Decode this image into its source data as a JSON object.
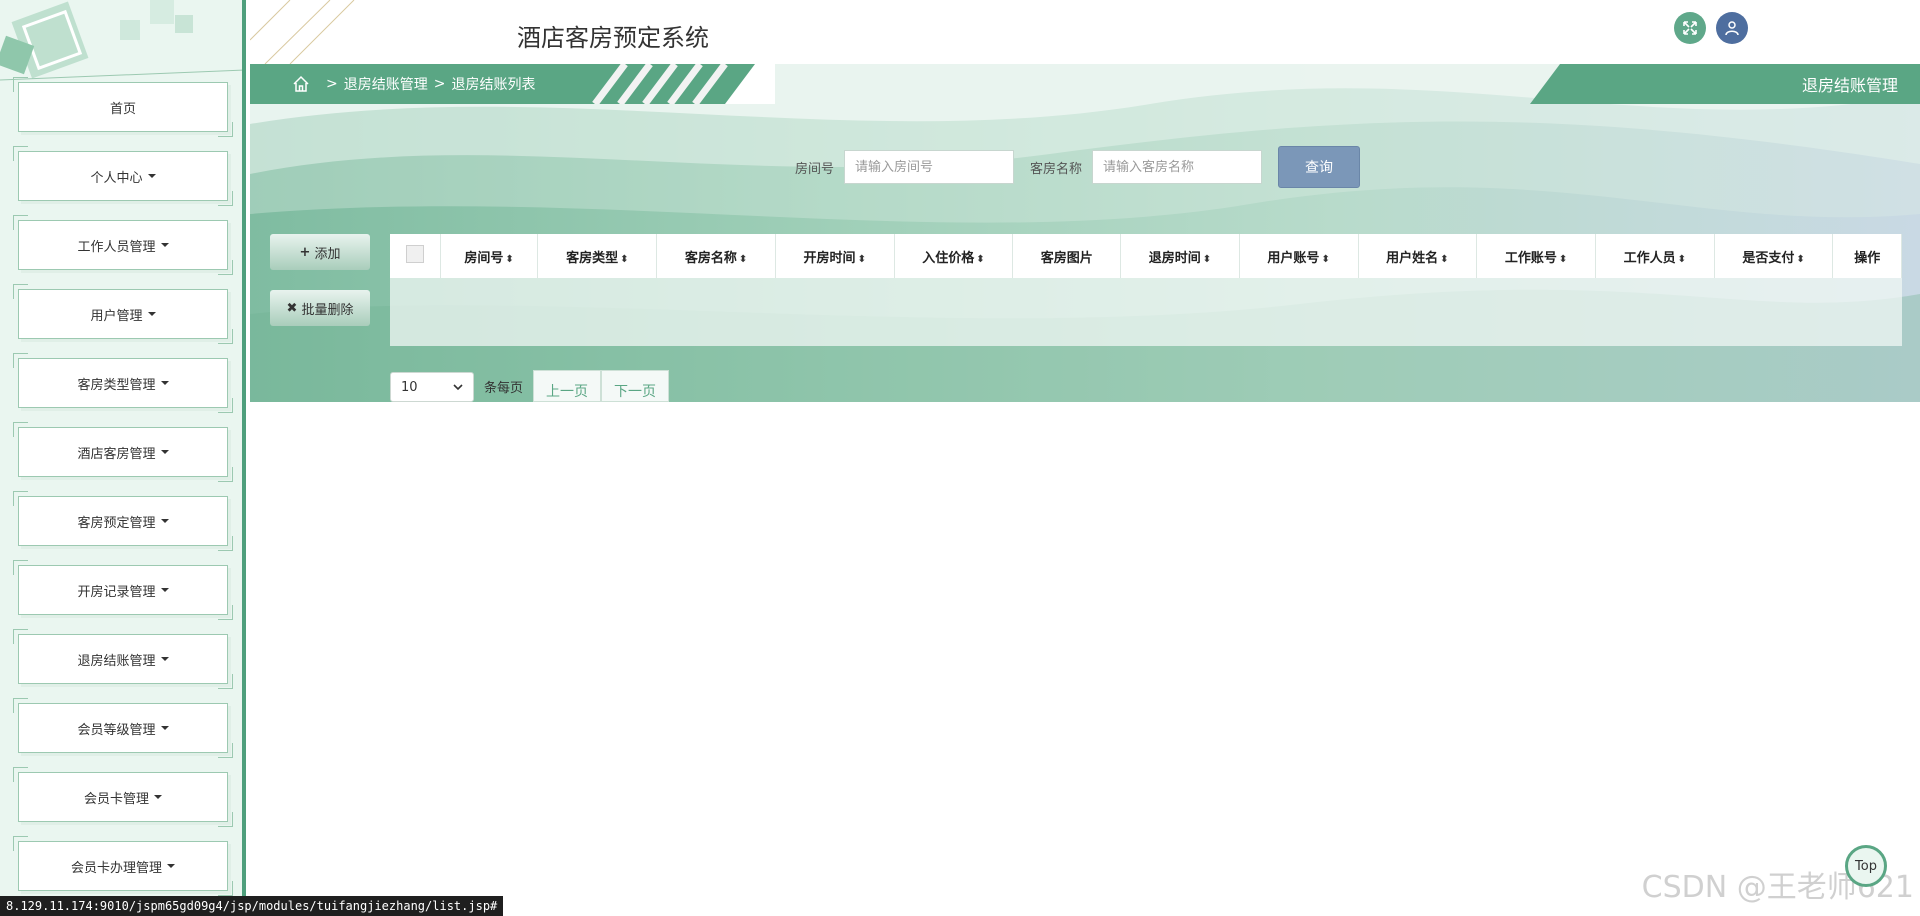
{
  "app": {
    "title": "酒店客房预定系统"
  },
  "sidebar": {
    "items": [
      {
        "label": "首页",
        "has_caret": false
      },
      {
        "label": "个人中心",
        "has_caret": true
      },
      {
        "label": "工作人员管理",
        "has_caret": true
      },
      {
        "label": "用户管理",
        "has_caret": true
      },
      {
        "label": "客房类型管理",
        "has_caret": true
      },
      {
        "label": "酒店客房管理",
        "has_caret": true
      },
      {
        "label": "客房预定管理",
        "has_caret": true
      },
      {
        "label": "开房记录管理",
        "has_caret": true
      },
      {
        "label": "退房结账管理",
        "has_caret": true
      },
      {
        "label": "会员等级管理",
        "has_caret": true
      },
      {
        "label": "会员卡管理",
        "has_caret": true
      },
      {
        "label": "会员卡办理管理",
        "has_caret": true
      }
    ]
  },
  "header": {
    "expand_icon": "expand-icon",
    "user_icon": "user-icon"
  },
  "breadcrumb": {
    "sep": ">",
    "level1": "退房结账管理",
    "level2": "退房结账列表"
  },
  "page_tag": "退房结账管理",
  "search": {
    "room_label": "房间号",
    "room_placeholder": "请输入房间号",
    "name_label": "客房名称",
    "name_placeholder": "请输入客房名称",
    "query_label": "查询"
  },
  "actions": {
    "add_label": "添加",
    "batch_delete_label": "批量删除"
  },
  "table": {
    "columns": [
      {
        "label": "房间号",
        "sortable": true
      },
      {
        "label": "客房类型",
        "sortable": true
      },
      {
        "label": "客房名称",
        "sortable": true
      },
      {
        "label": "开房时间",
        "sortable": true
      },
      {
        "label": "入住价格",
        "sortable": true
      },
      {
        "label": "客房图片",
        "sortable": false
      },
      {
        "label": "退房时间",
        "sortable": true
      },
      {
        "label": "用户账号",
        "sortable": true
      },
      {
        "label": "用户姓名",
        "sortable": true
      },
      {
        "label": "工作账号",
        "sortable": true
      },
      {
        "label": "工作人员",
        "sortable": true
      },
      {
        "label": "是否支付",
        "sortable": true
      },
      {
        "label": "操作",
        "sortable": false
      }
    ],
    "rows": []
  },
  "pager": {
    "page_size": "10",
    "per_page_label": "条每页",
    "prev_label": "上一页",
    "next_label": "下一页"
  },
  "status_url": "8.129.11.174:9010/jspm65gd09g4/jsp/modules/tuifangjiezhang/list.jsp#",
  "watermark": "CSDN @王老师621",
  "top_button": "Top",
  "colors": {
    "primary": "#5aa684",
    "sidebar_bg": "#eaf6f0",
    "query_btn": "#7b97b8"
  }
}
